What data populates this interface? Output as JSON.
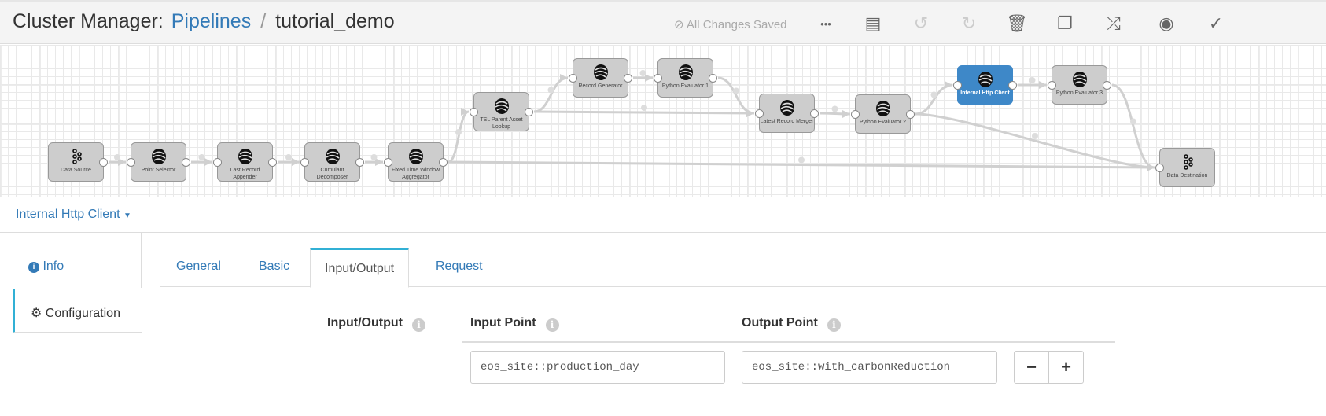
{
  "header": {
    "app": "Cluster Manager:",
    "breadcrumb_link": "Pipelines",
    "breadcrumb_sep": "/",
    "pipeline": "tutorial_demo",
    "saved_status": "All Changes Saved"
  },
  "toolbar": [
    {
      "name": "more-icon",
      "glyph": "•••",
      "disabled": false
    },
    {
      "name": "document-icon",
      "glyph": "▤",
      "disabled": false
    },
    {
      "name": "undo-icon",
      "glyph": "↺",
      "disabled": true
    },
    {
      "name": "redo-icon",
      "glyph": "↻",
      "disabled": true
    },
    {
      "name": "trash-icon",
      "glyph": "🗑",
      "disabled": false
    },
    {
      "name": "copy-icon",
      "glyph": "❐",
      "disabled": false
    },
    {
      "name": "shuffle-icon",
      "glyph": "⤮",
      "disabled": false
    },
    {
      "name": "eye-icon",
      "glyph": "◉",
      "disabled": false
    },
    {
      "name": "check-circle-icon",
      "glyph": "✓",
      "disabled": false
    }
  ],
  "graph": {
    "selected_color": "#3e88c8",
    "nodes": [
      {
        "label": "Data Source",
        "icon": "kafka-icon"
      },
      {
        "label": "Point Selector",
        "icon": "pipeline-icon"
      },
      {
        "label": "Last Record Appender",
        "icon": "pipeline-icon"
      },
      {
        "label": "Cumulant Decomposer",
        "icon": "pipeline-icon"
      },
      {
        "label": "Fixed Time Window Aggregator",
        "icon": "pipeline-icon"
      },
      {
        "label": "TSL Parent Asset Lookup",
        "icon": "pipeline-icon"
      },
      {
        "label": "Record Generator",
        "icon": "pipeline-icon"
      },
      {
        "label": "Python Evaluator 1",
        "icon": "pipeline-icon"
      },
      {
        "label": "Latest Record Merger",
        "icon": "pipeline-icon"
      },
      {
        "label": "Python Evaluator 2",
        "icon": "pipeline-icon"
      },
      {
        "label": "Internal Http Client",
        "icon": "pipeline-icon",
        "selected": true
      },
      {
        "label": "Python Evaluator 3",
        "icon": "pipeline-icon"
      },
      {
        "label": "Data Destination",
        "icon": "kafka-icon"
      }
    ],
    "edges": [
      [
        0,
        1
      ],
      [
        1,
        2
      ],
      [
        2,
        3
      ],
      [
        3,
        4
      ],
      [
        4,
        5
      ],
      [
        4,
        12
      ],
      [
        5,
        6
      ],
      [
        5,
        8
      ],
      [
        6,
        7
      ],
      [
        7,
        8
      ],
      [
        8,
        9
      ],
      [
        9,
        10
      ],
      [
        9,
        12
      ],
      [
        10,
        11
      ],
      [
        11,
        12
      ]
    ]
  },
  "panel": {
    "node_dropdown": "Internal Http Client",
    "side_tabs": [
      {
        "label": "Info",
        "icon": "info-icon"
      },
      {
        "label": "Configuration",
        "icon": "gear-icon",
        "active": true
      }
    ],
    "tabs": [
      {
        "label": "General"
      },
      {
        "label": "Basic"
      },
      {
        "label": "Input/Output",
        "active": true
      },
      {
        "label": "Request"
      }
    ],
    "section_label": "Input/Output",
    "col_input": "Input Point",
    "col_output": "Output Point",
    "input_value": "eos_site::production_day",
    "output_value": "eos_site::with_carbonReduction",
    "remove_label": "−",
    "add_label": "+"
  }
}
